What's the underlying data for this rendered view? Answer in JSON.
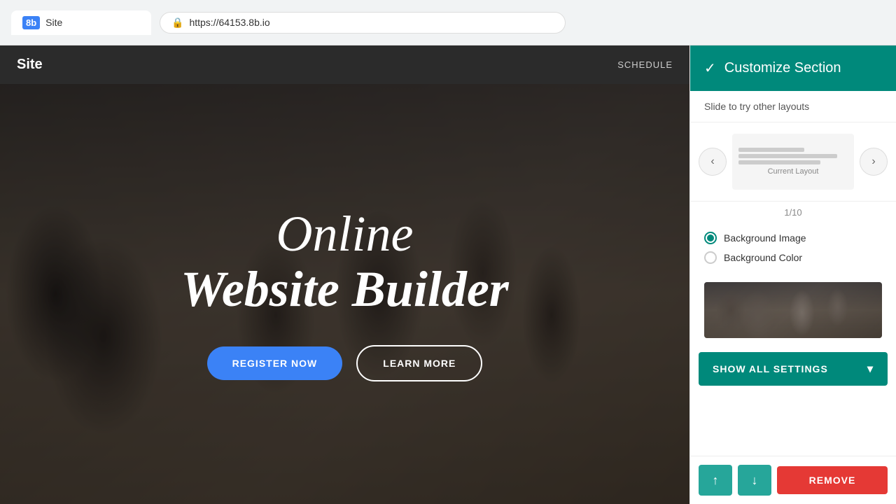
{
  "browser": {
    "tab_logo": "8b",
    "tab_title": "Site",
    "url": "https://64153.8b.io",
    "lock_icon": "🔒"
  },
  "site_nav": {
    "logo": "Site",
    "links": [
      "SCHEDULE"
    ]
  },
  "hero": {
    "title_line1": "Online",
    "title_line2": "Website Builder",
    "btn_register": "REGISTER NOW",
    "btn_learn": "LEARN MORE"
  },
  "panel": {
    "header_title": "Customize Section",
    "check_icon": "✓",
    "subtitle": "Slide to try other layouts",
    "layout_label": "Current\nLayout",
    "layout_counter": "1/10",
    "bg_image_label": "Background Image",
    "bg_color_label": "Background Color",
    "show_settings_label": "SHOW ALL SETTINGS",
    "chevron_icon": "▾",
    "prev_icon": "‹",
    "next_icon": "›",
    "up_arrow": "↑",
    "down_arrow": "↓",
    "remove_label": "REMOVE"
  },
  "colors": {
    "teal": "#00897b",
    "teal_light": "#26a69a",
    "blue": "#3b82f6",
    "red": "#e53935"
  }
}
